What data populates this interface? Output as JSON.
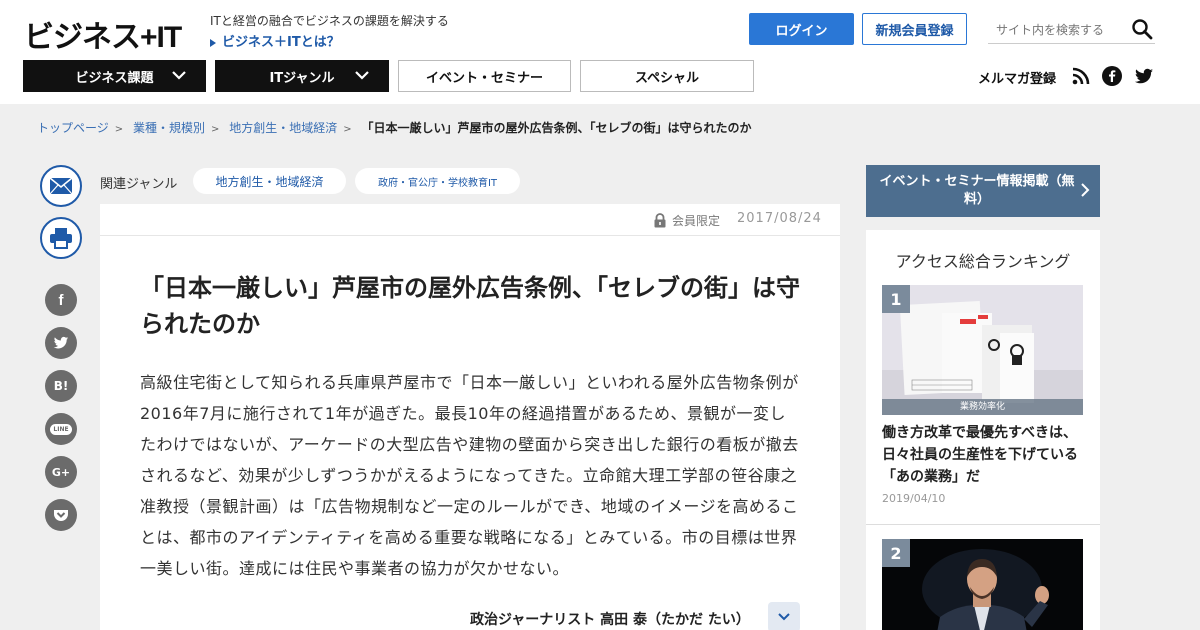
{
  "header": {
    "logo": "ビジネス+IT",
    "tagline": "ITと経営の融合でビジネスの課題を解決する",
    "about_link": "ビジネス＋ITとは？",
    "login": "ログイン",
    "register": "新規会員登録",
    "search_placeholder": "サイト内を検索する"
  },
  "nav": {
    "items": [
      "ビジネス課題",
      "ITジャンル",
      "イベント・セミナー",
      "スペシャル"
    ],
    "mailmag": "メルマガ登録"
  },
  "breadcrumb": {
    "items": [
      "トップページ",
      "業種・規模別",
      "地方創生・地域経済"
    ],
    "current": "「日本一厳しい」芦屋市の屋外広告条例、「セレブの街」は守られたのか"
  },
  "share": [
    "f",
    "t",
    "B!",
    "LINE",
    "G+",
    "pocket"
  ],
  "genre": {
    "label": "関連ジャンル",
    "tags": [
      "地方創生・地域経済",
      "政府・官公庁・学校教育IT"
    ]
  },
  "article": {
    "member_only": "会員限定",
    "date": "2017/08/24",
    "title": "「日本一厳しい」芦屋市の屋外広告条例、「セレブの街」は守られたのか",
    "lead": "高級住宅街として知られる兵庫県芦屋市で「日本一厳しい」といわれる屋外広告物条例が2016年7月に施行されて1年が過ぎた。最長10年の経過措置があるため、景観が一変したわけではないが、アーケードの大型広告や建物の壁面から突き出した銀行の看板が撤去されるなど、効果が少しずつうかがえるようになってきた。立命館大理工学部の笹谷康之准教授（景観計画）は「広告物規制など一定のルールができ、地域のイメージを高めることは、都市のアイデンティティを高める重要な戦略になる」とみている。市の目標は世界一美しい街。達成には住民や事業者の協力が欠かせない。",
    "author": "政治ジャーナリスト 高田 泰（たかだ たい）"
  },
  "sidebar": {
    "event_button": "イベント・セミナー情報掲載（無料）",
    "ranking_title": "アクセス総合ランキング",
    "ranking": [
      {
        "rank": "1",
        "tag": "業務効率化",
        "title": "働き方改革で最優先すべきは、日々社員の生産性を下げている「あの業務」だ",
        "date": "2019/04/10"
      },
      {
        "rank": "2",
        "tag": "",
        "title": "",
        "date": ""
      }
    ]
  },
  "colors": {
    "accent_blue": "#2a77d6",
    "link_blue": "#1f5aa8",
    "nav_dark": "#111111",
    "event_button": "#4d6e8f"
  }
}
